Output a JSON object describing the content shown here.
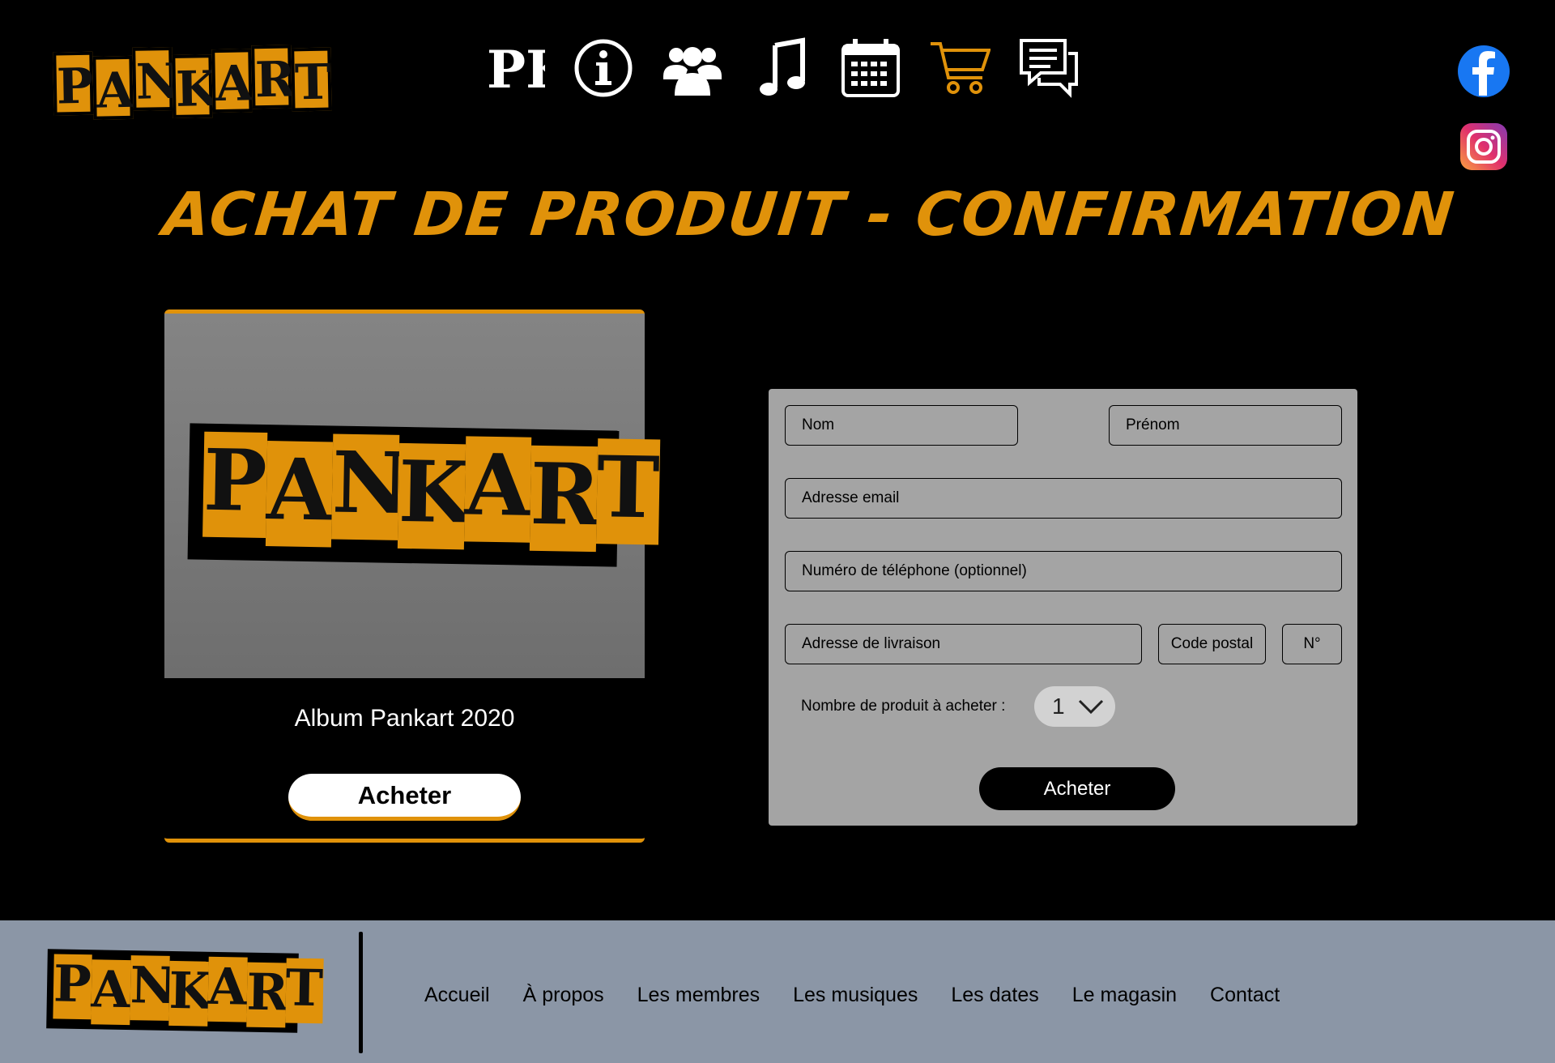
{
  "brand": {
    "logo_text": "PANKART",
    "accent_color": "#e0920a",
    "footer_color": "#8b96a6"
  },
  "header": {
    "nav_icons": [
      {
        "name": "pk-monogram-icon",
        "text": "PK"
      },
      {
        "name": "info-icon"
      },
      {
        "name": "members-icon"
      },
      {
        "name": "music-note-icon"
      },
      {
        "name": "calendar-icon"
      },
      {
        "name": "cart-icon",
        "active": true
      },
      {
        "name": "chat-icon"
      }
    ],
    "social": [
      "facebook-icon",
      "instagram-icon"
    ]
  },
  "page_title": "ACHAT DE PRODUIT - CONFIRMATION",
  "product": {
    "name": "Album Pankart 2020",
    "buy_label": "Acheter"
  },
  "form": {
    "fields": {
      "nom": "Nom",
      "prenom": "Prénom",
      "email": "Adresse email",
      "phone": "Numéro de téléphone (optionnel)",
      "address": "Adresse de livraison",
      "postal": "Code postal",
      "number": "N°"
    },
    "quantity_label": "Nombre de produit à acheter :",
    "quantity_value": "1",
    "submit_label": "Acheter"
  },
  "footer": {
    "links": [
      "Accueil",
      "À propos",
      "Les membres",
      "Les musiques",
      "Les dates",
      "Le magasin",
      "Contact"
    ]
  }
}
